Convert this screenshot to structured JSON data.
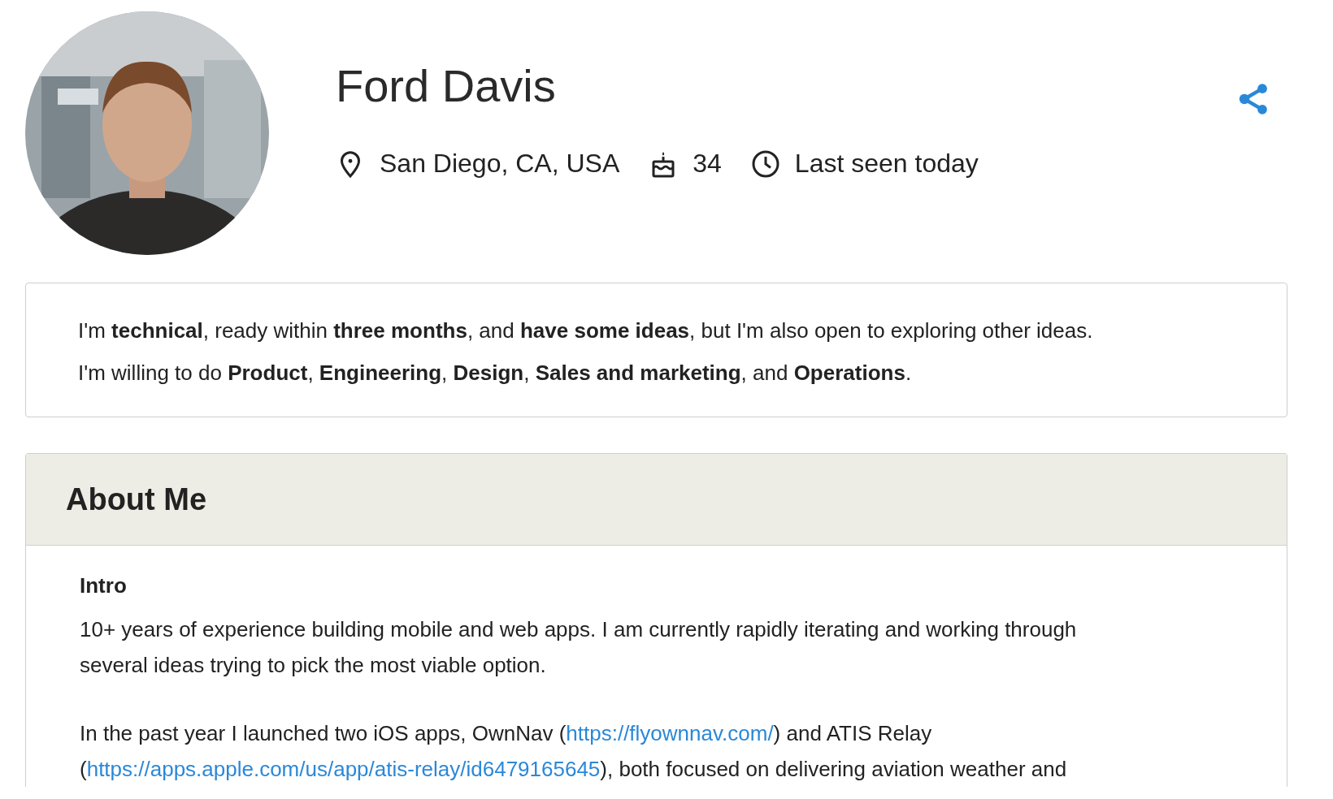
{
  "profile": {
    "name": "Ford Davis",
    "location": "San Diego, CA, USA",
    "age": "34",
    "last_seen": "Last seen today"
  },
  "pitch": [
    "I'm **technical**, ready within **three months**, and **have some ideas**, but I'm also open to exploring other ideas.",
    "I'm willing to do **Product**, **Engineering**, **Design**, **Sales and marketing**, and **Operations**."
  ],
  "about": {
    "title": "About Me",
    "sections": [
      {
        "heading": "Intro",
        "paragraphs": [
          [
            {
              "kind": "text",
              "text": "10+ years of experience building mobile and web apps. I am currently rapidly iterating and working through several ideas trying to pick the most viable option."
            }
          ],
          [
            {
              "kind": "text",
              "text": "In the past year I launched two iOS apps, OwnNav ("
            },
            {
              "kind": "link",
              "text": "https://flyownnav.com/"
            },
            {
              "kind": "text",
              "text": ") and ATIS Relay ("
            },
            {
              "kind": "link",
              "text": "https://apps.apple.com/us/app/atis-relay/id6479165645"
            },
            {
              "kind": "text",
              "text": "), both focused on delivering aviation weather and"
            }
          ]
        ]
      }
    ]
  }
}
